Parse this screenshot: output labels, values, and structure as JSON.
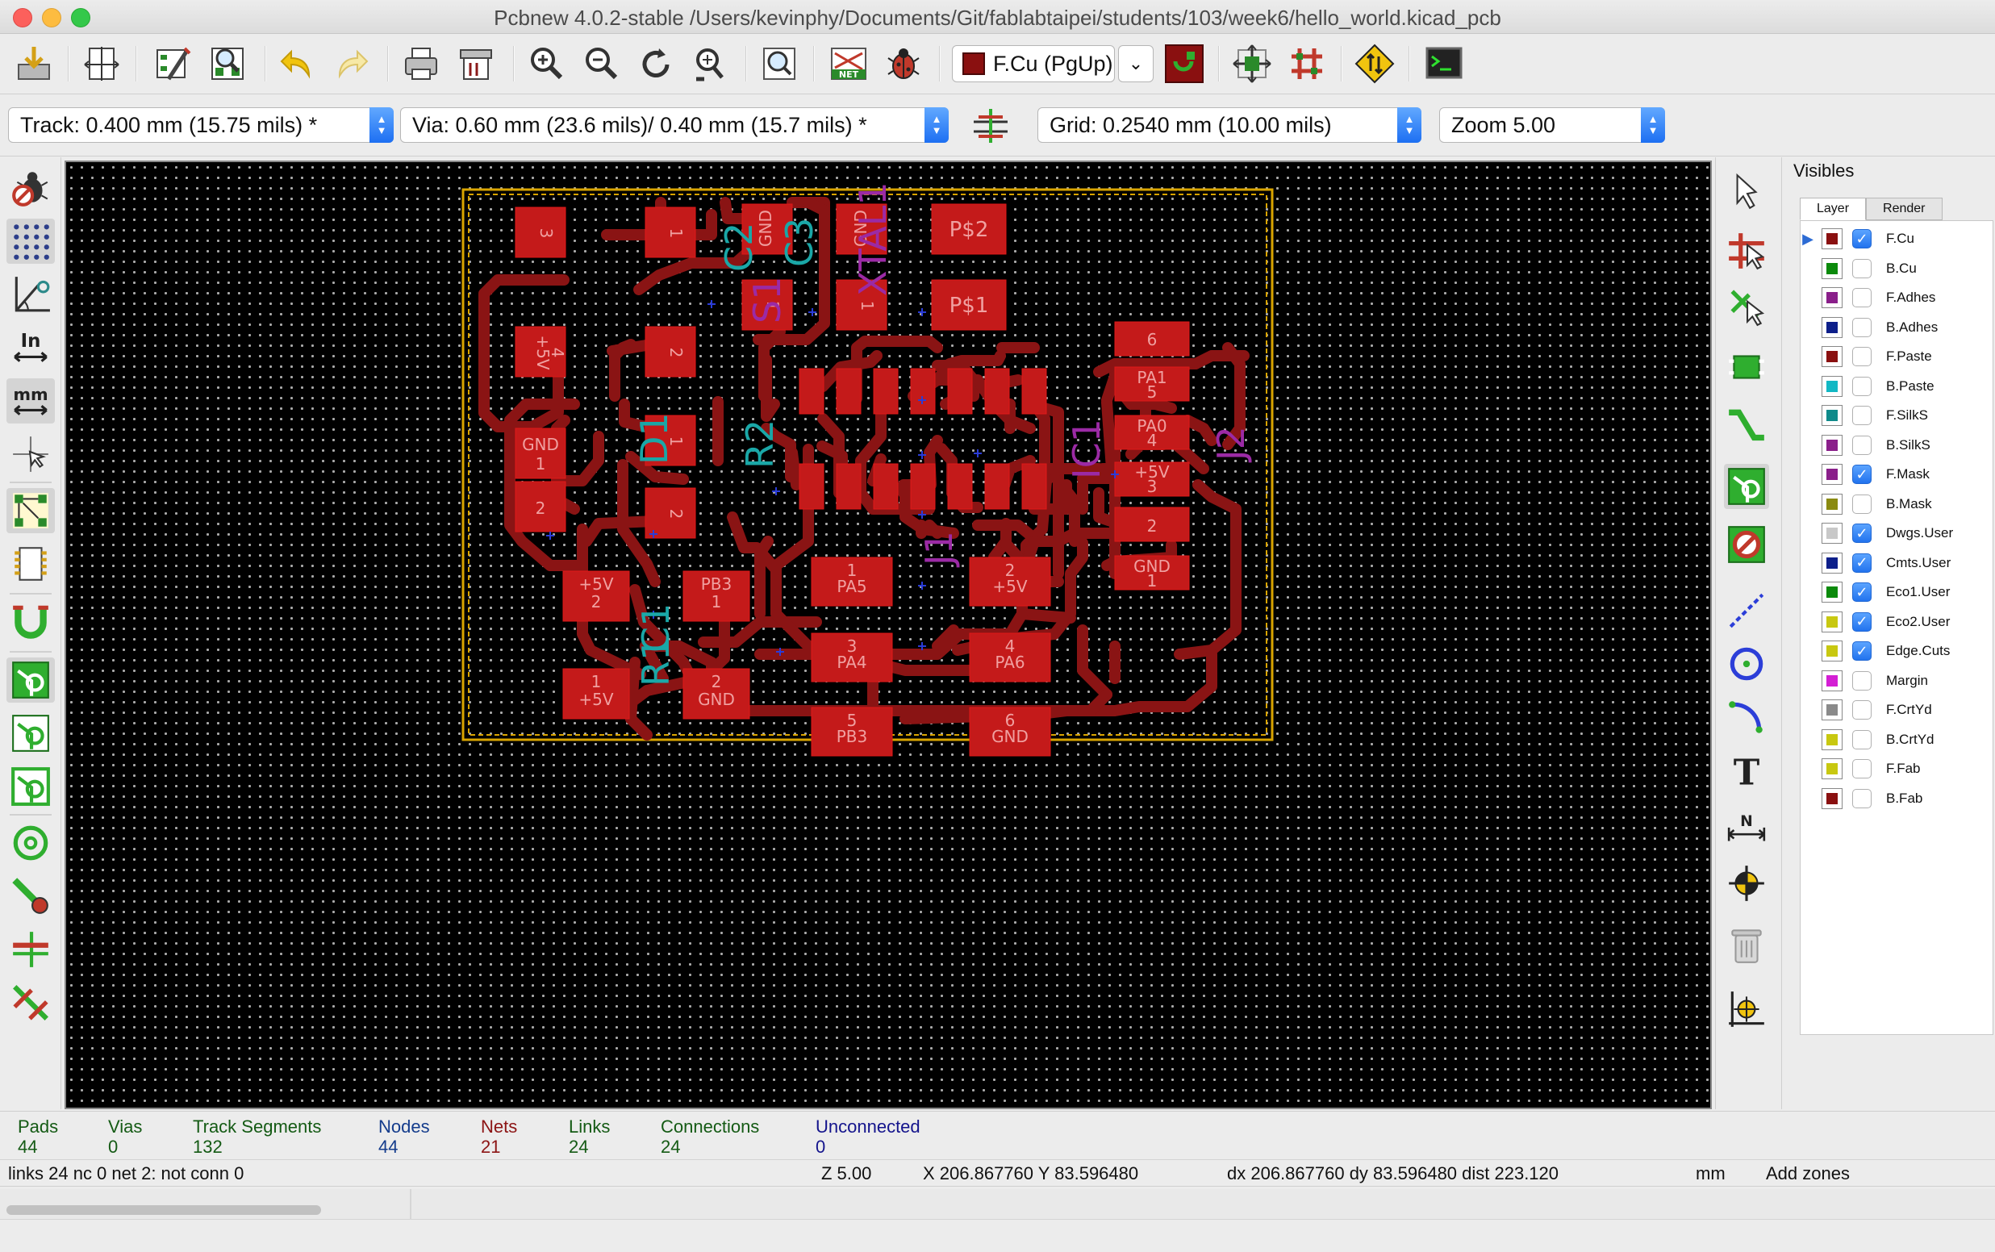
{
  "window": {
    "title": "Pcbnew 4.0.2-stable /Users/kevinphy/Documents/Git/fablabtaipei/students/103/week6/hello_world.kicad_pcb"
  },
  "toolbar": {
    "active_layer": "F.Cu (PgUp)",
    "layer_color": "#8a1010",
    "icons": [
      "save-board-icon",
      "page-settings-icon",
      "board-setup-icon",
      "library-browser-icon",
      "undo-icon",
      "redo-icon",
      "print-icon",
      "plot-icon",
      "zoom-in-icon",
      "zoom-out-icon",
      "redraw-icon",
      "zoom-fit-icon",
      "find-icon",
      "netlist-icon",
      "drc-icon",
      "layer-pair-icon",
      "microwave-icon",
      "autoplace-icon",
      "autoroute-icon",
      "scripting-console-icon"
    ]
  },
  "options": {
    "track": "Track: 0.400 mm (15.75 mils) *",
    "via": "Via: 0.60 mm (23.6 mils)/ 0.40 mm (15.7 mils) *",
    "grid": "Grid: 0.2540 mm (10.00 mils)",
    "zoom": "Zoom 5.00"
  },
  "board": {
    "colors": {
      "copper": "#c41a1a",
      "track": "#8a1414",
      "outline": "#d9a400",
      "silk_cyan": "#1aa7a7",
      "silk_magenta": "#9b2aa5",
      "pad_text": "#f0a0a0"
    },
    "refs": {
      "s1": "S1",
      "c2": "C2",
      "c3": "C3",
      "xtal1": "XTAL1",
      "d1": "D1",
      "r2": "R2",
      "ic1": "IC1",
      "j2": "J2",
      "j1": "J1",
      "c1": "C1",
      "r1": "R1"
    },
    "pads": {
      "p3": "3",
      "p1a": "1",
      "gnd_a": "GND",
      "gnd_b": "GND",
      "ps2": "P$2",
      "ps1": "P$1",
      "p1b": "1",
      "p1c": "1",
      "p5v_a": "+5V",
      "p4a": "4",
      "p2a": "2",
      "p1d": "1",
      "p2b": "2",
      "p2c": "2",
      "gnd_c": "GND",
      "p1e": "1",
      "p6": "6",
      "pa1": "PA1",
      "p5": "5",
      "pa0": "PA0",
      "p4b": "4",
      "p5v_b": "+5V",
      "p3b": "3",
      "p2d": "2",
      "gnd_d": "GND",
      "p1f": "1",
      "h1": "1",
      "pa5": "PA5",
      "h2": "2",
      "p5v_c": "+5V",
      "h3": "3",
      "pa4": "PA4",
      "h4": "4",
      "pa6": "PA6",
      "h5": "5",
      "pb3": "PB3",
      "h6": "6",
      "gnd_e": "GND",
      "p5v_d": "+5V",
      "p2e": "2",
      "pb3b": "PB3",
      "p1g": "1",
      "p1h": "1",
      "p5v_e": "+5V",
      "p2f": "2",
      "gnd_f": "GND"
    }
  },
  "visibles": {
    "title": "Visibles",
    "tabs": [
      "Layer",
      "Render"
    ],
    "layers": [
      {
        "name": "F.Cu",
        "color": "#8a1010",
        "checked": true,
        "active": true
      },
      {
        "name": "B.Cu",
        "color": "#0b8a0b",
        "checked": false
      },
      {
        "name": "F.Adhes",
        "color": "#8a1f8a",
        "checked": false
      },
      {
        "name": "B.Adhes",
        "color": "#0d1f8a",
        "checked": false
      },
      {
        "name": "F.Paste",
        "color": "#8a1010",
        "checked": false
      },
      {
        "name": "B.Paste",
        "color": "#12b8c4",
        "checked": false
      },
      {
        "name": "F.SilkS",
        "color": "#0f8a8a",
        "checked": false
      },
      {
        "name": "B.SilkS",
        "color": "#8a1f8a",
        "checked": false
      },
      {
        "name": "F.Mask",
        "color": "#8a1f8a",
        "checked": true
      },
      {
        "name": "B.Mask",
        "color": "#8a8a10",
        "checked": false
      },
      {
        "name": "Dwgs.User",
        "color": "#c8c8c8",
        "checked": true
      },
      {
        "name": "Cmts.User",
        "color": "#0d1f8a",
        "checked": true
      },
      {
        "name": "Eco1.User",
        "color": "#0b8a0b",
        "checked": true
      },
      {
        "name": "Eco2.User",
        "color": "#c8c810",
        "checked": true
      },
      {
        "name": "Edge.Cuts",
        "color": "#c8c810",
        "checked": true
      },
      {
        "name": "Margin",
        "color": "#d41fd4",
        "checked": false
      },
      {
        "name": "F.CrtYd",
        "color": "#8a8a8a",
        "checked": false
      },
      {
        "name": "B.CrtYd",
        "color": "#c8c810",
        "checked": false
      },
      {
        "name": "F.Fab",
        "color": "#c8c810",
        "checked": false
      },
      {
        "name": "B.Fab",
        "color": "#8a1010",
        "checked": false
      }
    ]
  },
  "info": {
    "pads": {
      "label": "Pads",
      "value": "44",
      "color": "#145a14"
    },
    "vias": {
      "label": "Vias",
      "value": "0",
      "color": "#145a14"
    },
    "tracks": {
      "label": "Track Segments",
      "value": "132",
      "color": "#145a14"
    },
    "nodes": {
      "label": "Nodes",
      "value": "44",
      "color": "#143c8c"
    },
    "nets": {
      "label": "Nets",
      "value": "21",
      "color": "#8c1414"
    },
    "links": {
      "label": "Links",
      "value": "24",
      "color": "#145a14"
    },
    "connections": {
      "label": "Connections",
      "value": "24",
      "color": "#145a14"
    },
    "unconnected": {
      "label": "Unconnected",
      "value": "0",
      "color": "#14148c"
    }
  },
  "status": {
    "msg": "links 24 nc 0  net 2: not conn 0",
    "zoom": "Z 5.00",
    "xy": "X 206.867760  Y 83.596480",
    "dxy": "dx 206.867760  dy 83.596480  dist 223.120",
    "units": "mm",
    "mode": "Add zones"
  }
}
